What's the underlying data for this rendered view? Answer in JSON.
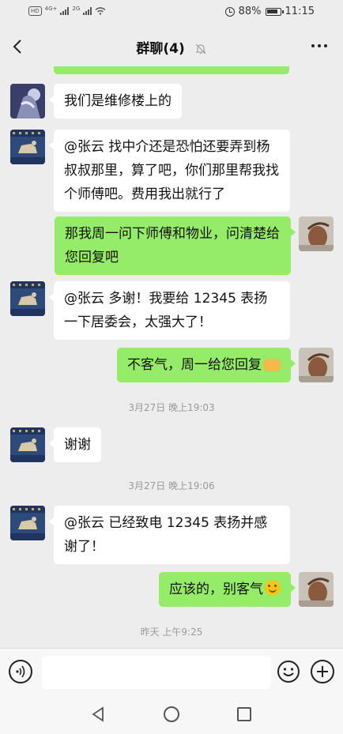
{
  "status_bar": {
    "hd": "HD",
    "net1": "4G+",
    "net2": "2G",
    "battery_percent": "88%",
    "time": "11:15"
  },
  "header": {
    "title": "群聊(4)",
    "icons": [
      "back-arrow-icon",
      "mute-bell-icon",
      "more-icon"
    ]
  },
  "messages": [
    {
      "side": "in",
      "text": "我们是维修楼上的"
    },
    {
      "side": "in",
      "text": "@张云  找中介还是恐怕还要弄到杨叔叔那里，算了吧，你们那里帮我找个师傅吧。费用我出就行了"
    },
    {
      "side": "out",
      "text": "那我周一问下师傅和物业，问清楚给您回复吧"
    },
    {
      "side": "in",
      "text": "@张云  多谢！我要给 12345 表扬一下居委会，太强大了！"
    },
    {
      "side": "out",
      "text": "不客气，周一给您回复",
      "emoji": "handshake-emoji"
    },
    {
      "type": "time",
      "text": "3月27日 晚上19:03"
    },
    {
      "side": "in",
      "text": "谢谢"
    },
    {
      "type": "time",
      "text": "3月27日 晚上19:06"
    },
    {
      "side": "in",
      "text": "@张云  已经致电 12345 表扬并感谢了！"
    },
    {
      "side": "out",
      "text": "应该的，别客气",
      "emoji": "smile-emoji"
    },
    {
      "type": "time",
      "text": "昨天 上午9:25"
    }
  ],
  "input_bar": {
    "value": "",
    "icons": [
      "voice-icon",
      "emoji-icon",
      "plus-icon"
    ]
  },
  "colors": {
    "background": "#ededed",
    "outgoing_bubble": "#95ec69",
    "incoming_bubble": "#ffffff",
    "timestamp": "#9a9a9a"
  }
}
